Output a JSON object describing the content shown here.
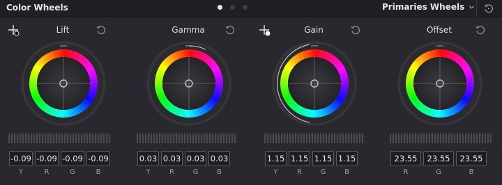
{
  "header": {
    "title": "Color Wheels",
    "page_dots": 3,
    "mode": "Primaries Wheels"
  },
  "wheels": [
    {
      "label": "Lift",
      "values": [
        {
          "value": "-0.09",
          "channel": "Y"
        },
        {
          "value": "-0.09",
          "channel": "R"
        },
        {
          "value": "-0.09",
          "channel": "G"
        },
        {
          "value": "-0.09",
          "channel": "B"
        }
      ]
    },
    {
      "label": "Gamma",
      "values": [
        {
          "value": "0.03",
          "channel": "Y"
        },
        {
          "value": "0.03",
          "channel": "R"
        },
        {
          "value": "0.03",
          "channel": "G"
        },
        {
          "value": "0.03",
          "channel": "B"
        }
      ]
    },
    {
      "label": "Gain",
      "values": [
        {
          "value": "1.15",
          "channel": "Y"
        },
        {
          "value": "1.15",
          "channel": "R"
        },
        {
          "value": "1.15",
          "channel": "G"
        },
        {
          "value": "1.15",
          "channel": "B"
        }
      ]
    },
    {
      "label": "Offset",
      "values": [
        {
          "value": "23.55",
          "channel": "R"
        },
        {
          "value": "23.55",
          "channel": "G"
        },
        {
          "value": "23.55",
          "channel": "B"
        }
      ]
    }
  ],
  "icons": {
    "picker": "eyedropper-crosshair-icon",
    "reset": "reset-icon",
    "chevron": "chevron-down-icon"
  },
  "colors": {
    "background": "#28282e",
    "header": "#1f1f24",
    "text": "#dedede"
  }
}
